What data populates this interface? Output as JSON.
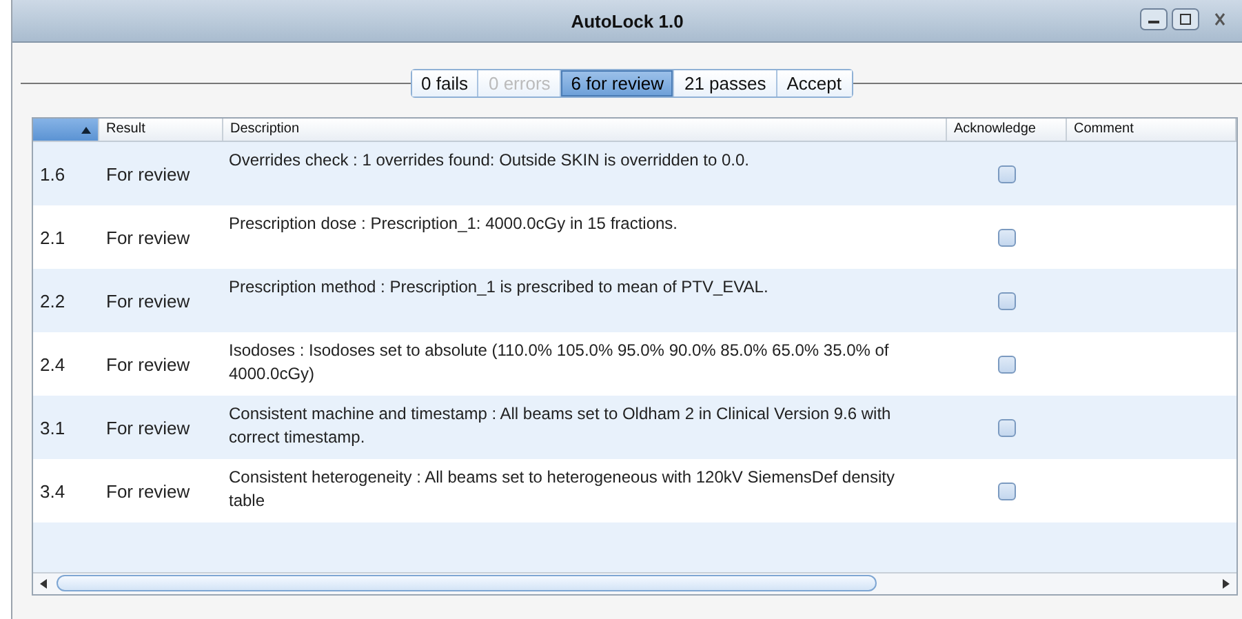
{
  "window": {
    "title": "AutoLock 1.0"
  },
  "filters": [
    {
      "label": "0 fails",
      "selected": false,
      "disabled": false
    },
    {
      "label": "0 errors",
      "selected": false,
      "disabled": true
    },
    {
      "label": "6 for review",
      "selected": true,
      "disabled": false
    },
    {
      "label": "21 passes",
      "selected": false,
      "disabled": false
    },
    {
      "label": "Accept",
      "selected": false,
      "disabled": false
    }
  ],
  "table": {
    "columns": [
      "Result",
      "Description",
      "Acknowledge",
      "Comment"
    ],
    "rows": [
      {
        "id": "1.6",
        "result": "For review",
        "description": "Overrides check : 1 overrides found: Outside SKIN is overridden to 0.0.",
        "acknowledged": false
      },
      {
        "id": "2.1",
        "result": "For review",
        "description": "Prescription dose : Prescription_1: 4000.0cGy in 15 fractions.",
        "acknowledged": false
      },
      {
        "id": "2.2",
        "result": "For review",
        "description": "Prescription method : Prescription_1 is prescribed to mean of PTV_EVAL.",
        "acknowledged": false
      },
      {
        "id": "2.4",
        "result": "For review",
        "description": "Isodoses : Isodoses set to absolute (110.0% 105.0% 95.0% 90.0% 85.0% 65.0% 35.0% of 4000.0cGy)",
        "acknowledged": false
      },
      {
        "id": "3.1",
        "result": "For review",
        "description": "Consistent machine and timestamp : All beams set to Oldham 2 in Clinical Version 9.6 with correct timestamp.",
        "acknowledged": false
      },
      {
        "id": "3.4",
        "result": "For review",
        "description": "Consistent heterogeneity : All beams set to heterogeneous with 120kV SiemensDef density table",
        "acknowledged": false
      }
    ]
  }
}
